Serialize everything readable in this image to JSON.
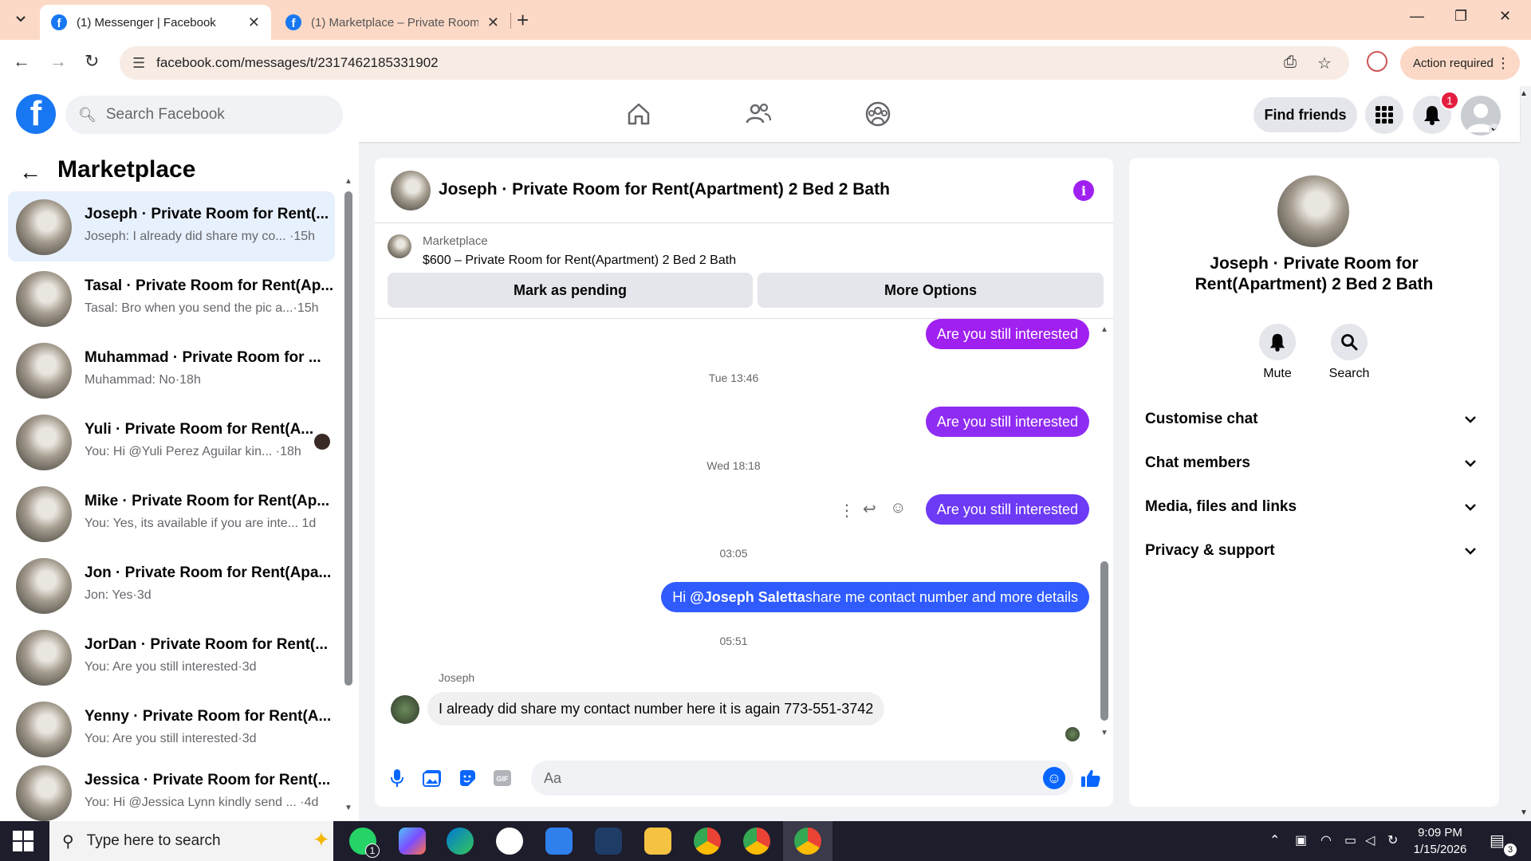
{
  "browser": {
    "tabs": [
      {
        "title": "(1) Messenger | Facebook",
        "active": true
      },
      {
        "title": "(1) Marketplace – Private Room",
        "active": false
      }
    ],
    "url": "facebook.com/messages/t/2317462185331902",
    "action_required": "Action required"
  },
  "header": {
    "search_placeholder": "Search Facebook",
    "find_friends": "Find friends",
    "notification_count": "1"
  },
  "sidebar": {
    "title": "Marketplace",
    "conversations": [
      {
        "name": "Joseph · Private Room for Rent(...",
        "preview": "Joseph: I already did share my co... ·15h",
        "active": true
      },
      {
        "name": "Tasal · Private Room for Rent(Ap...",
        "preview": "Tasal: Bro when you send the pic a...·15h"
      },
      {
        "name": "Muhammad · Private Room for ...",
        "preview": "Muhammad: No·18h"
      },
      {
        "name": "Yuli · Private Room for Rent(A...",
        "preview": "You: Hi @Yuli Perez Aguilar kin... ·18h"
      },
      {
        "name": "Mike · Private Room for Rent(Ap...",
        "preview": "You: Yes, its available if you are inte... 1d"
      },
      {
        "name": "Jon · Private Room for Rent(Apa...",
        "preview": "Jon: Yes·3d"
      },
      {
        "name": "JorDan · Private Room for Rent(...",
        "preview": "You: Are you still interested·3d"
      },
      {
        "name": "Yenny · Private Room for Rent(A...",
        "preview": "You: Are you still interested·3d"
      },
      {
        "name": "Jessica · Private Room for Rent(...",
        "preview": "You: Hi @Jessica Lynn kindly send ... ·4d"
      }
    ]
  },
  "chat": {
    "title": "Joseph · Private Room for Rent(Apartment) 2 Bed 2 Bath",
    "marketplace_label": "Marketplace",
    "listing": "$600 – Private Room for Rent(Apartment) 2 Bed 2 Bath",
    "mark_pending": "Mark as pending",
    "more_options": "More Options",
    "messages": {
      "m1": "Are you still interested",
      "t1": "Tue 13:46",
      "m2": "Are you still interested",
      "t2": "Wed 18:18",
      "m3": "Are you still interested",
      "t3": "03:05",
      "m4_pre": "Hi ",
      "m4_mention": "@Joseph Saletta",
      "m4_post": "share me contact number and more details",
      "t4": "05:51",
      "sender": "Joseph",
      "m5": "I already did share my contact number here it is again 773-551-3742"
    },
    "composer_placeholder": "Aa"
  },
  "right_panel": {
    "title": "Joseph · Private Room for Rent(Apartment) 2 Bed 2 Bath",
    "mute": "Mute",
    "search": "Search",
    "rows": [
      "Customise chat",
      "Chat members",
      "Media, files and links",
      "Privacy & support"
    ]
  },
  "taskbar": {
    "search_placeholder": "Type here to search",
    "time": "9:09 PM",
    "date": "1/15/2026",
    "whatsapp_badge": "1",
    "notif_count": "3"
  },
  "colors": {
    "fb_blue": "#1877f2",
    "bubble_purple": "#a020f0",
    "bubble_blue": "#2f5bff",
    "tab_bar": "#fcd9c6"
  }
}
